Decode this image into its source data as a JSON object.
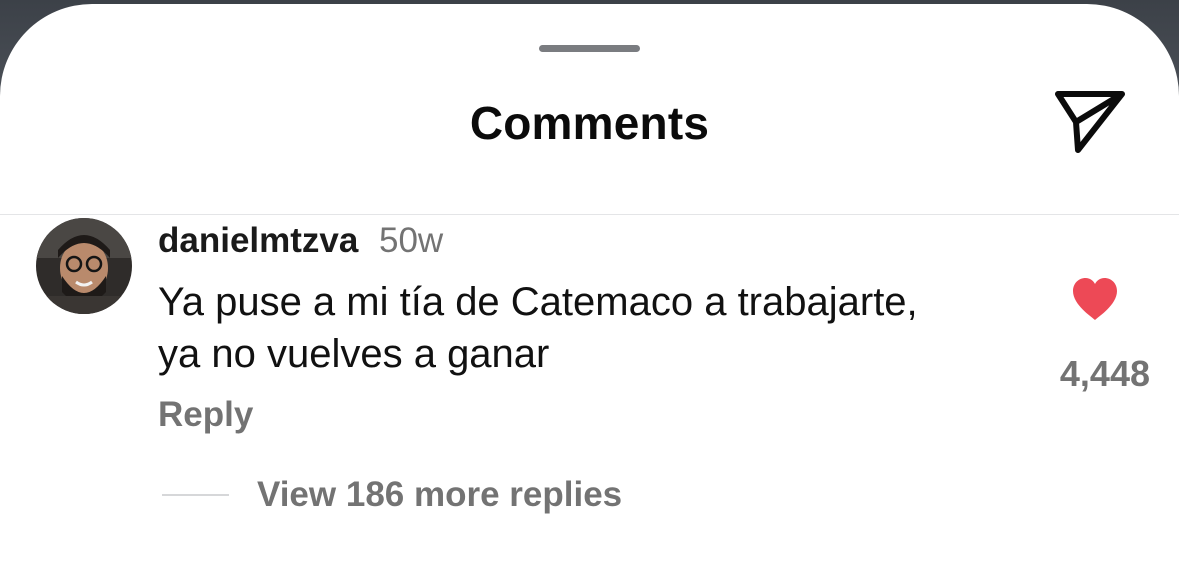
{
  "header": {
    "title": "Comments",
    "send_icon": "send-icon"
  },
  "comment": {
    "username": "danielmtzva",
    "time": "50w",
    "text_line1": "Ya puse a mi tía de Catemaco a trabajarte,",
    "text_line2": "ya no vuelves a ganar",
    "like_count": "4,448",
    "liked": true,
    "like_color": "#ed4956",
    "reply_label": "Reply",
    "view_replies_label": "View 186 more replies"
  },
  "colors": {
    "text_primary": "#111111",
    "text_secondary": "#737373",
    "background": "#ffffff"
  }
}
